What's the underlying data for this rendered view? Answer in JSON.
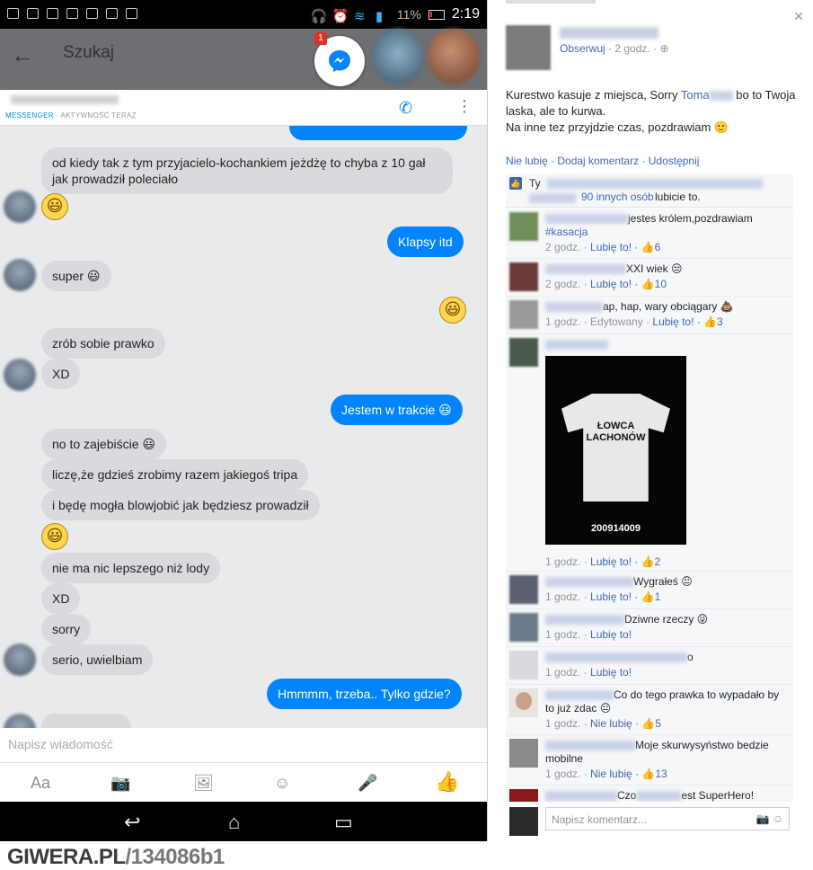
{
  "status_bar": {
    "battery": "11%",
    "time": "2:19"
  },
  "messenger": {
    "search_label": "Szukaj",
    "chathead_badge": "1",
    "conversation_sub": "MESSENGER",
    "conversation_activity": " · AKTYWNOŚĆ TERAZ",
    "composer_placeholder": "Napisz wiadomość",
    "composer_tools": {
      "text_button": "Aa"
    },
    "messages": [
      {
        "side": "in",
        "text": "od kiedy tak z tym przyjacielo-kochankiem jeżdżę to chyba z 10 gał jak prowadził poleciało"
      },
      {
        "side": "in",
        "text": "😃"
      },
      {
        "side": "out",
        "text": "Klapsy itd"
      },
      {
        "side": "in",
        "text": "super 😃"
      },
      {
        "side": "out",
        "text": "😃"
      },
      {
        "side": "in",
        "text": "zrób sobie prawko"
      },
      {
        "side": "in",
        "text": "XD"
      },
      {
        "side": "out",
        "text": "Jestem w trakcie 😃"
      },
      {
        "side": "in",
        "text": "no to zajebiście 😃"
      },
      {
        "side": "in",
        "text": "liczę,że gdzieś zrobimy razem jakiegoś tripa"
      },
      {
        "side": "in",
        "text": "i będę mogła blowjobić jak będziesz prowadził"
      },
      {
        "side": "in",
        "text": "😃"
      },
      {
        "side": "in",
        "text": "nie ma nic lepszego niż lody"
      },
      {
        "side": "in",
        "text": "XD"
      },
      {
        "side": "in",
        "text": "sorry"
      },
      {
        "side": "in",
        "text": "serio, uwielbiam"
      },
      {
        "side": "out",
        "text": "Hmmmm, trzeba.. Tylko gdzie?"
      }
    ]
  },
  "watermark": {
    "site": "GIWERA.PL",
    "id": "/134086b1"
  },
  "facebook": {
    "follow": "Obserwuj",
    "post_time": " · 2 godz. · ",
    "post_text_1": "Kurestwo kasuje z miejsca, Sorry ",
    "post_tag": "Toma",
    "post_text_2": " bo to Twoja laska, ale to kurwa.",
    "post_text_3": "Na inne tez przyjdzie czas, pozdrawiam 🙂",
    "actions": "Nie lubię · Dodaj komentarz · Udostępnij",
    "likes_prefix": "Ty",
    "likes_others": "90 innych osób",
    "likes_suffix": " lubicie to.",
    "comments": [
      {
        "text": "jestes królem,pozdrawiam",
        "text2": "#kasacja",
        "meta": "2 godz. · ",
        "like": "Lubię to!",
        "count": " · 👍6"
      },
      {
        "text": "XXI wiek 😒",
        "meta": "2 godz. · ",
        "like": "Lubię to!",
        "count": " · 👍10"
      },
      {
        "text": "ap, hap, wary obciągary 💩",
        "meta": "1 godz. · Edytowany · ",
        "like": "Lubię to!",
        "count": " · 👍3"
      },
      {
        "shirt_line1": "ŁOWCA",
        "shirt_line2": "LACHONÓW",
        "shirt_code": "200914009",
        "meta": "1 godz. · ",
        "like": "Lubię to!",
        "count": " · 👍2"
      },
      {
        "text": "Wygrałeś 😐",
        "meta": "1 godz. · ",
        "like": "Lubię to!",
        "count": " · 👍1"
      },
      {
        "text": "Dziwne rzeczy 😜",
        "meta": "1 godz. · ",
        "like": "Lubię to!",
        "count": ""
      },
      {
        "text": "o",
        "meta": "1 godz. · ",
        "like": "Lubię to!",
        "count": ""
      },
      {
        "text": "Co do tego prawka to wypadało by to już zdac 😐",
        "meta": "1 godz. · ",
        "like": "Nie lubię",
        "count": " · 👍5"
      },
      {
        "text": "Moje skurwysyństwo bedzie mobilne",
        "meta": "1 godz. · ",
        "like": "Nie lubię",
        "count": " · 👍13"
      },
      {
        "text": "Czo",
        "text_tail": "est SuperHero!"
      }
    ],
    "comment_placeholder": "Napisz komentarz..."
  }
}
